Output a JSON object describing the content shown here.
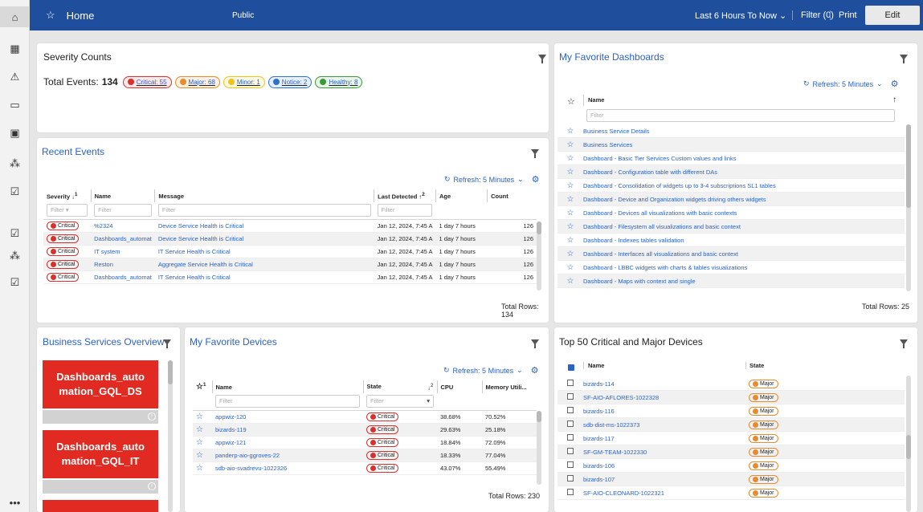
{
  "rail": {
    "icons": [
      "home-icon",
      "grid-icon",
      "warning-icon",
      "monitor-icon",
      "briefcase-icon",
      "hierarchy-icon",
      "clipboard-check-icon",
      "clipboard-check-icon",
      "hierarchy-icon",
      "clipboard-check-icon",
      "more-icon"
    ]
  },
  "topbar": {
    "home_label": "Home",
    "public_label": "Public",
    "time_range": "Last 6 Hours To Now",
    "filter_label": "Filter (0)",
    "print_label": "Print",
    "edit_label": "Edit"
  },
  "severity": {
    "title": "Severity Counts",
    "total_label": "Total Events:",
    "total_value": "134",
    "pills": [
      {
        "label": "Critical: 55",
        "color": "#d9302d",
        "bg": "#fde8e8"
      },
      {
        "label": "Major: 68",
        "color": "#e88a2e",
        "bg": "#fdf0e3"
      },
      {
        "label": "Minor: 1",
        "color": "#f2c21b",
        "bg": "#fdf8e2"
      },
      {
        "label": "Notice: 2",
        "color": "#2f72c9",
        "bg": "#e6effb"
      },
      {
        "label": "Healthy: 8",
        "color": "#3a9a3a",
        "bg": "#e8f5e8"
      }
    ]
  },
  "recent": {
    "title": "Recent Events",
    "refresh": "Refresh: 5 Minutes",
    "headers": {
      "severity": "Severity",
      "name": "Name",
      "message": "Message",
      "last": "Last Detected",
      "age": "Age",
      "count": "Count"
    },
    "sort1": "1",
    "sort2": "2",
    "filter": "Filter",
    "rows": [
      {
        "sev": "Critical",
        "name": "%2324",
        "msg": "Device Service Health is Critical",
        "last": "Jan 12, 2024, 7:45 A",
        "age": "1 day 7 hours",
        "count": "126"
      },
      {
        "sev": "Critical",
        "name": "Dashboards_automat",
        "msg": "Device Service Health is Critical",
        "last": "Jan 12, 2024, 7:45 A",
        "age": "1 day 7 hours",
        "count": "126"
      },
      {
        "sev": "Critical",
        "name": "IT system",
        "msg": "IT Service Health is Critical",
        "last": "Jan 12, 2024, 7:45 A",
        "age": "1 day 7 hours",
        "count": "126"
      },
      {
        "sev": "Critical",
        "name": "Reston",
        "msg": "Aggregate Service Health is Critical",
        "last": "Jan 12, 2024, 7:45 A",
        "age": "1 day 7 hours",
        "count": "126"
      },
      {
        "sev": "Critical",
        "name": "Dashboards_automat",
        "msg": "IT Service Health is Critical",
        "last": "Jan 12, 2024, 7:45 A",
        "age": "1 day 7 hours",
        "count": "126"
      }
    ],
    "total": "Total Rows: 134"
  },
  "favdash": {
    "title": "My Favorite Dashboards",
    "refresh": "Refresh: 5 Minutes",
    "name_header": "Name",
    "filter": "Filter",
    "rows": [
      "Business Service Details",
      "Business Services",
      "Dashboard - Basic Tier Services Custom values and links",
      "Dashboard - Configuration table with different DAs",
      "Dashboard - Consolidation of widgets up to 3-4 subscriptions SL1 tables",
      "Dashboard - Device and Organization widgets driving others widgets",
      "Dashboard - Devices all visualizations with basic contexts",
      "Dashboard - Filesystem all visualizations and basic context",
      "Dashboard - Indexes tables validation",
      "Dashboard - Interfaces all visualizations and basic context",
      "Dashboard - LBBC widgets with charts & tables visualizations",
      "Dashboard - Maps with context and single"
    ],
    "total": "Total Rows: 25"
  },
  "bizsvc": {
    "title": "Business Services Overview",
    "cards": [
      "Dashboards_automation_GQL_DS",
      "Dashboards_automation_GQL_IT"
    ]
  },
  "favdev": {
    "title": "My Favorite Devices",
    "refresh": "Refresh: 5 Minutes",
    "headers": {
      "name": "Name",
      "state": "State",
      "cpu": "CPU",
      "mem": "Memory Utili..."
    },
    "sort1": "1",
    "sort2": "2",
    "filter": "Filter",
    "rows": [
      {
        "name": "appwiz-120",
        "state": "Critical",
        "cpu": "38.68%",
        "mem": "70.52%"
      },
      {
        "name": "bizards-119",
        "state": "Critical",
        "cpu": "29.63%",
        "mem": "25.18%"
      },
      {
        "name": "appwiz-121",
        "state": "Critical",
        "cpu": "18.84%",
        "mem": "72.09%"
      },
      {
        "name": "panderp-aio-ggroves-22",
        "state": "Critical",
        "cpu": "18.33%",
        "mem": "77.04%"
      },
      {
        "name": "sdb-aio-svadrevu-1022326",
        "state": "Critical",
        "cpu": "43.07%",
        "mem": "55.49%"
      }
    ],
    "total": "Total Rows: 230"
  },
  "top50": {
    "title": "Top 50 Critical and Major Devices",
    "headers": {
      "name": "Name",
      "state": "State"
    },
    "rows": [
      {
        "name": "bizards-114",
        "state": "Major"
      },
      {
        "name": "SF-AIO-AFLORES-1022328",
        "state": "Major"
      },
      {
        "name": "bizards-116",
        "state": "Major"
      },
      {
        "name": "sdb-dist-ms-1022373",
        "state": "Major"
      },
      {
        "name": "bizards-117",
        "state": "Major"
      },
      {
        "name": "SF-GM-TEAM-1022330",
        "state": "Major"
      },
      {
        "name": "bizards-106",
        "state": "Major"
      },
      {
        "name": "bizards-107",
        "state": "Major"
      },
      {
        "name": "SF-AIO-CLEONARD-1022321",
        "state": "Major"
      }
    ]
  },
  "colors": {
    "topbar": "#1e4e9c",
    "link": "#2a62c6",
    "critical": "#d9302d",
    "major": "#e88a2e",
    "card": "#e02a22"
  }
}
